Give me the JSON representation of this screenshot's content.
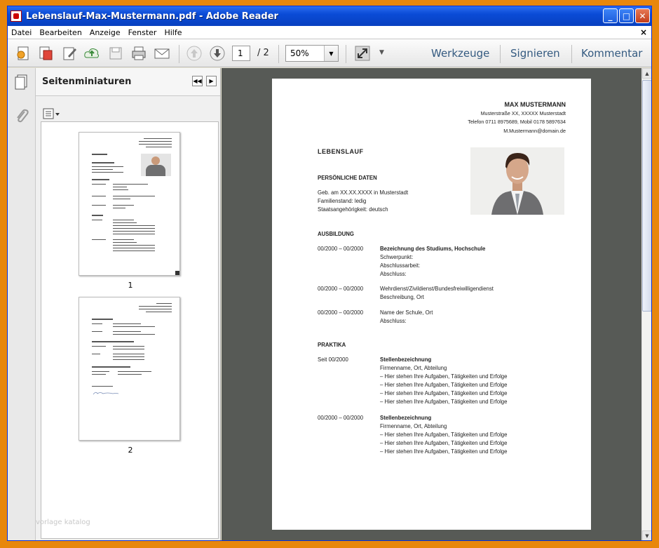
{
  "window": {
    "title": "Lebenslauf-Max-Mustermann.pdf - Adobe Reader"
  },
  "menu": [
    "Datei",
    "Bearbeiten",
    "Anzeige",
    "Fenster",
    "Hilfe"
  ],
  "toolbar": {
    "page_current": "1",
    "page_total": "/ 2",
    "zoom": "50%",
    "werkzeuge": "Werkzeuge",
    "signieren": "Signieren",
    "kommentar": "Kommentar"
  },
  "sidebar": {
    "title": "Seitenminiaturen",
    "thumb_labels": [
      "1",
      "2"
    ],
    "watermark": "vorlage katalog"
  },
  "doc": {
    "name": "MAX MUSTERMANN",
    "contact": [
      "Musterstraße XX, XXXXX Musterstadt",
      "Telefon 0711 8975689, Mobil 0178 5897634",
      "M.Mustermann@domain.de"
    ],
    "heading": "LEBENSLAUF",
    "personal": {
      "title": "PERSÖNLICHE DATEN",
      "lines": [
        "Geb. am XX.XX.XXXX in Musterstadt",
        "Familienstand: ledig",
        "Staatsangehörigkeit: deutsch"
      ]
    },
    "ausbildung": {
      "title": "AUSBILDUNG",
      "entries": [
        {
          "date": "00/2000 – 00/2000",
          "title": "Bezeichnung des Studiums, Hochschule",
          "lines": [
            "Schwerpunkt:",
            "Abschlussarbeit:",
            "Abschluss:"
          ]
        },
        {
          "date": "00/2000 – 00/2000",
          "title": "Wehrdienst/Zivildienst/Bundesfreiwilligendienst",
          "lines": [
            "Beschreibung, Ort"
          ]
        },
        {
          "date": "00/2000 – 00/2000",
          "title": "Name der Schule, Ort",
          "lines": [
            "Abschluss:"
          ]
        }
      ]
    },
    "praktika": {
      "title": "PRAKTIKA",
      "entries": [
        {
          "date": "Seit 00/2000",
          "title": "Stellenbezeichnung",
          "lines": [
            "Firmenname, Ort, Abteilung",
            "– Hier stehen Ihre Aufgaben, Tätigkeiten und Erfolge",
            "– Hier stehen Ihre Aufgaben, Tätigkeiten und Erfolge",
            "– Hier stehen Ihre Aufgaben, Tätigkeiten und Erfolge",
            "– Hier stehen Ihre Aufgaben, Tätigkeiten und Erfolge"
          ]
        },
        {
          "date": "00/2000 – 00/2000",
          "title": "Stellenbezeichnung",
          "lines": [
            "Firmenname, Ort, Abteilung",
            "– Hier stehen Ihre Aufgaben, Tätigkeiten und Erfolge",
            "– Hier stehen Ihre Aufgaben, Tätigkeiten und Erfolge",
            "– Hier stehen Ihre Aufgaben, Tätigkeiten und Erfolge"
          ]
        }
      ]
    }
  }
}
